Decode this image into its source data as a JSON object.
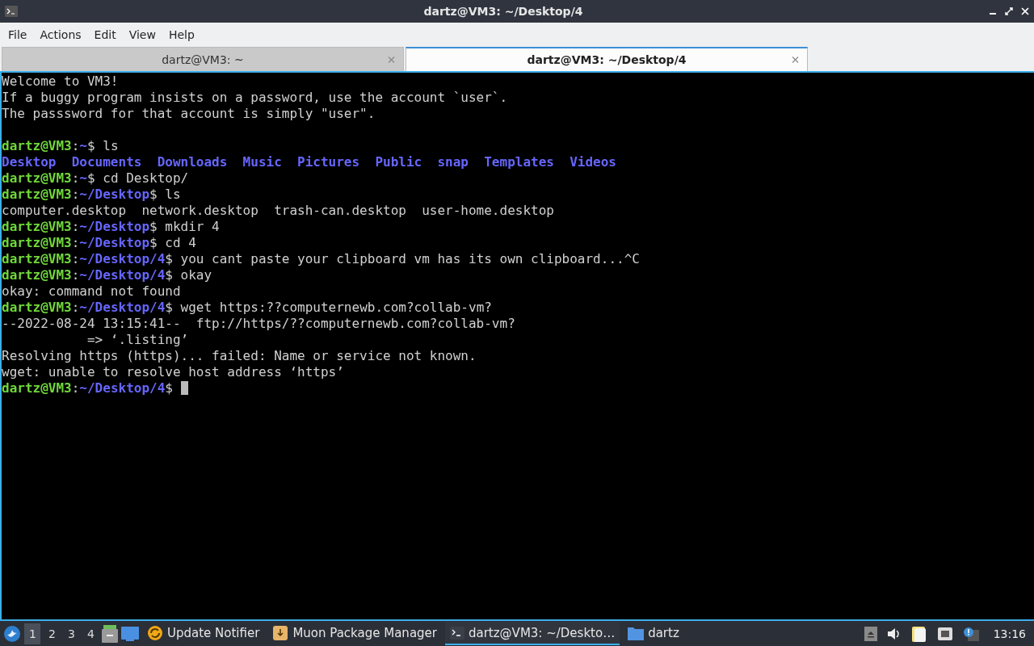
{
  "window": {
    "title": "dartz@VM3: ~/Desktop/4"
  },
  "menu": [
    "File",
    "Actions",
    "Edit",
    "View",
    "Help"
  ],
  "tabs": [
    {
      "label": "dartz@VM3: ~",
      "selected": false
    },
    {
      "label": "dartz@VM3: ~/Desktop/4",
      "selected": true
    }
  ],
  "terminal": {
    "lines": [
      [
        {
          "kind": "plain",
          "text": "Welcome to VM3!"
        }
      ],
      [
        {
          "kind": "plain",
          "text": "If a buggy program insists on a password, use the account `user`."
        }
      ],
      [
        {
          "kind": "plain",
          "text": "The passsword for that account is simply \"user\"."
        }
      ],
      {
        "kind": "blank"
      },
      [
        {
          "kind": "user",
          "text": "dartz@VM3"
        },
        {
          "kind": "plain",
          "text": ":"
        },
        {
          "kind": "path",
          "text": "~"
        },
        {
          "kind": "plain",
          "text": "$ ls"
        }
      ],
      [
        {
          "kind": "path",
          "text": "Desktop  Documents  Downloads  Music  Pictures  Public  snap  Templates  Videos"
        }
      ],
      [
        {
          "kind": "user",
          "text": "dartz@VM3"
        },
        {
          "kind": "plain",
          "text": ":"
        },
        {
          "kind": "path",
          "text": "~"
        },
        {
          "kind": "plain",
          "text": "$ cd Desktop/"
        }
      ],
      [
        {
          "kind": "user",
          "text": "dartz@VM3"
        },
        {
          "kind": "plain",
          "text": ":"
        },
        {
          "kind": "path",
          "text": "~/Desktop"
        },
        {
          "kind": "plain",
          "text": "$ ls"
        }
      ],
      [
        {
          "kind": "plain",
          "text": "computer.desktop  network.desktop  trash-can.desktop  user-home.desktop"
        }
      ],
      [
        {
          "kind": "user",
          "text": "dartz@VM3"
        },
        {
          "kind": "plain",
          "text": ":"
        },
        {
          "kind": "path",
          "text": "~/Desktop"
        },
        {
          "kind": "plain",
          "text": "$ mkdir 4"
        }
      ],
      [
        {
          "kind": "user",
          "text": "dartz@VM3"
        },
        {
          "kind": "plain",
          "text": ":"
        },
        {
          "kind": "path",
          "text": "~/Desktop"
        },
        {
          "kind": "plain",
          "text": "$ cd 4"
        }
      ],
      [
        {
          "kind": "user",
          "text": "dartz@VM3"
        },
        {
          "kind": "plain",
          "text": ":"
        },
        {
          "kind": "path",
          "text": "~/Desktop/4"
        },
        {
          "kind": "plain",
          "text": "$ you cant paste your clipboard vm has its own clipboard...^C"
        }
      ],
      [
        {
          "kind": "user",
          "text": "dartz@VM3"
        },
        {
          "kind": "plain",
          "text": ":"
        },
        {
          "kind": "path",
          "text": "~/Desktop/4"
        },
        {
          "kind": "plain",
          "text": "$ okay"
        }
      ],
      [
        {
          "kind": "plain",
          "text": "okay: command not found"
        }
      ],
      [
        {
          "kind": "user",
          "text": "dartz@VM3"
        },
        {
          "kind": "plain",
          "text": ":"
        },
        {
          "kind": "path",
          "text": "~/Desktop/4"
        },
        {
          "kind": "plain",
          "text": "$ wget https:??computernewb.com?collab-vm?"
        }
      ],
      [
        {
          "kind": "plain",
          "text": "--2022-08-24 13:15:41--  ftp://https/??computernewb.com?collab-vm?"
        }
      ],
      [
        {
          "kind": "plain",
          "text": "           => ‘.listing’"
        }
      ],
      [
        {
          "kind": "plain",
          "text": "Resolving https (https)... failed: Name or service not known."
        }
      ],
      [
        {
          "kind": "plain",
          "text": "wget: unable to resolve host address ‘https’"
        }
      ],
      [
        {
          "kind": "user",
          "text": "dartz@VM3"
        },
        {
          "kind": "plain",
          "text": ":"
        },
        {
          "kind": "path",
          "text": "~/Desktop/4"
        },
        {
          "kind": "plain",
          "text": "$ "
        },
        {
          "kind": "cursor"
        }
      ]
    ]
  },
  "taskbar": {
    "workspaces": [
      {
        "label": "1",
        "selected": true
      },
      {
        "label": "2",
        "selected": false
      },
      {
        "label": "3",
        "selected": false
      },
      {
        "label": "4",
        "selected": false
      }
    ],
    "tasks": [
      {
        "kind": "update",
        "label": "Update Notifier",
        "selected": false
      },
      {
        "kind": "package",
        "label": "Muon Package Manager",
        "selected": false
      },
      {
        "kind": "terminal",
        "label": "dartz@VM3: ~/Deskto…",
        "selected": true
      },
      {
        "kind": "folder",
        "label": "dartz",
        "selected": false
      }
    ],
    "clock": "13:16"
  }
}
